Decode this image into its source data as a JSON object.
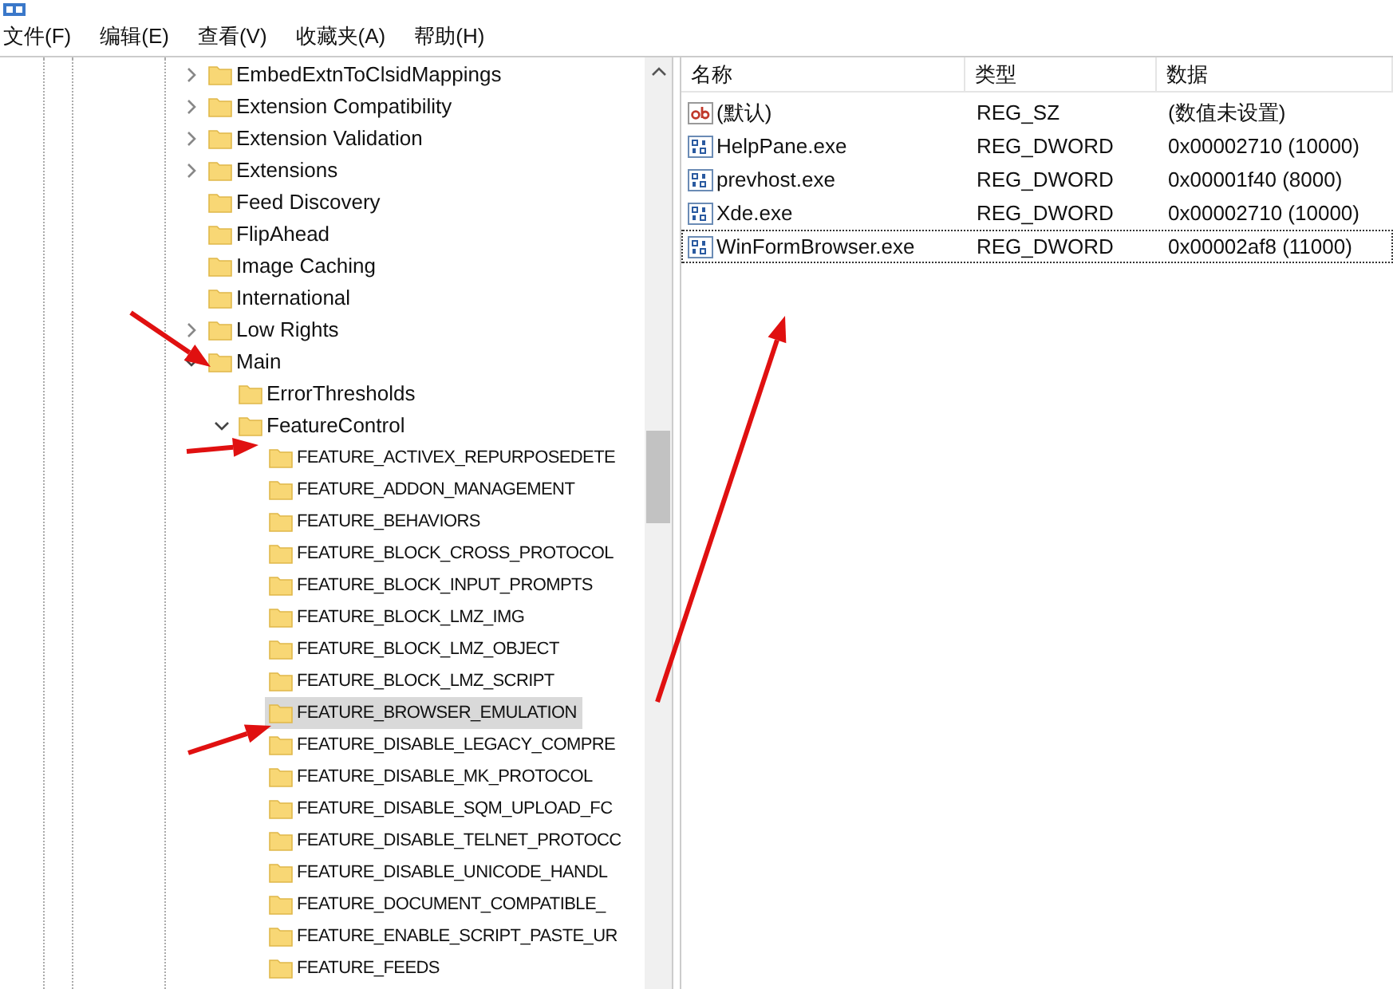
{
  "menu": [
    {
      "label": "文件(F)"
    },
    {
      "label": "编辑(E)"
    },
    {
      "label": "查看(V)"
    },
    {
      "label": "收藏夹(A)"
    },
    {
      "label": "帮助(H)"
    }
  ],
  "tree": [
    {
      "label": "EmbedExtnToClsidMappings",
      "expanded": false,
      "selected": false
    },
    {
      "label": "Extension Compatibility",
      "expanded": false,
      "selected": false
    },
    {
      "label": "Extension Validation",
      "expanded": false,
      "selected": false
    },
    {
      "label": "Extensions",
      "expanded": false,
      "selected": false
    },
    {
      "label": "Feed Discovery",
      "selected": false
    },
    {
      "label": "FlipAhead",
      "selected": false
    },
    {
      "label": "Image Caching",
      "selected": false
    },
    {
      "label": "International",
      "selected": false
    },
    {
      "label": "Low Rights",
      "expanded": false,
      "selected": false
    },
    {
      "label": "Main",
      "expanded": true,
      "selected": false,
      "children": [
        {
          "label": "ErrorThresholds",
          "selected": false
        },
        {
          "label": "FeatureControl",
          "expanded": true,
          "selected": false,
          "children": [
            {
              "label": "FEATURE_ACTIVEX_REPURPOSEDETE",
              "selected": false
            },
            {
              "label": "FEATURE_ADDON_MANAGEMENT",
              "selected": false
            },
            {
              "label": "FEATURE_BEHAVIORS",
              "selected": false
            },
            {
              "label": "FEATURE_BLOCK_CROSS_PROTOCOL",
              "selected": false
            },
            {
              "label": "FEATURE_BLOCK_INPUT_PROMPTS",
              "selected": false
            },
            {
              "label": "FEATURE_BLOCK_LMZ_IMG",
              "selected": false
            },
            {
              "label": "FEATURE_BLOCK_LMZ_OBJECT",
              "selected": false
            },
            {
              "label": "FEATURE_BLOCK_LMZ_SCRIPT",
              "selected": false
            },
            {
              "label": "FEATURE_BROWSER_EMULATION",
              "selected": true
            },
            {
              "label": "FEATURE_DISABLE_LEGACY_COMPRE",
              "selected": false
            },
            {
              "label": "FEATURE_DISABLE_MK_PROTOCOL",
              "selected": false
            },
            {
              "label": "FEATURE_DISABLE_SQM_UPLOAD_FC",
              "selected": false
            },
            {
              "label": "FEATURE_DISABLE_TELNET_PROTOCC",
              "selected": false
            },
            {
              "label": "FEATURE_DISABLE_UNICODE_HANDL",
              "selected": false
            },
            {
              "label": "FEATURE_DOCUMENT_COMPATIBLE_",
              "selected": false
            },
            {
              "label": "FEATURE_ENABLE_SCRIPT_PASTE_UR",
              "selected": false
            },
            {
              "label": "FEATURE_FEEDS",
              "selected": false
            }
          ]
        }
      ]
    }
  ],
  "values": {
    "columns": [
      "名称",
      "类型",
      "数据"
    ],
    "rows": [
      {
        "kind": "string",
        "name": "(默认)",
        "type": "REG_SZ",
        "data": "(数值未设置)",
        "focused": false
      },
      {
        "kind": "binary",
        "name": "HelpPane.exe",
        "type": "REG_DWORD",
        "data": "0x00002710 (10000)",
        "focused": false
      },
      {
        "kind": "binary",
        "name": "prevhost.exe",
        "type": "REG_DWORD",
        "data": "0x00001f40 (8000)",
        "focused": false
      },
      {
        "kind": "binary",
        "name": "Xde.exe",
        "type": "REG_DWORD",
        "data": "0x00002710 (10000)",
        "focused": false
      },
      {
        "kind": "binary",
        "name": "WinFormBrowser.exe",
        "type": "REG_DWORD",
        "data": "0x00002af8 (11000)",
        "focused": true
      }
    ]
  }
}
